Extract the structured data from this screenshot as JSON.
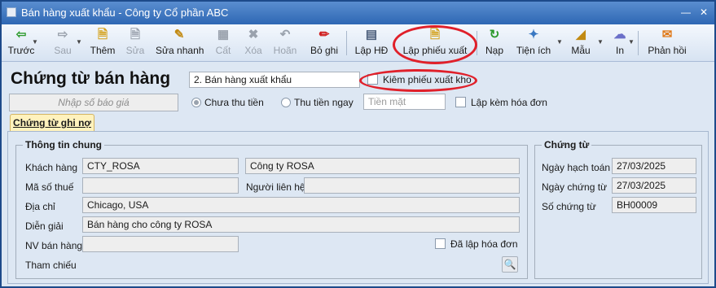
{
  "window": {
    "title": "Bán hàng xuất khẩu - Công ty Cổ phần ABC"
  },
  "toolbar": {
    "items": [
      {
        "label": "Trước",
        "icon": "arrow-left-icon"
      },
      {
        "label": "Sau",
        "icon": "arrow-right-icon"
      },
      {
        "label": "Thêm",
        "icon": "new-document-icon"
      },
      {
        "label": "Sửa",
        "icon": "edit-icon"
      },
      {
        "label": "Sửa nhanh",
        "icon": "quick-edit-icon"
      },
      {
        "label": "Cất",
        "icon": "save-icon"
      },
      {
        "label": "Xóa",
        "icon": "delete-icon"
      },
      {
        "label": "Hoãn",
        "icon": "undo-icon"
      },
      {
        "label": "Bỏ ghi",
        "icon": "unpost-icon"
      },
      {
        "label": "Lập HĐ",
        "icon": "invoice-icon"
      },
      {
        "label": "Lập phiếu xuất",
        "icon": "issue-slip-icon"
      },
      {
        "label": "Nạp",
        "icon": "refresh-icon"
      },
      {
        "label": "Tiện ích",
        "icon": "tools-icon"
      },
      {
        "label": "Mẫu",
        "icon": "template-icon"
      },
      {
        "label": "In",
        "icon": "print-icon"
      },
      {
        "label": "Phản hồi",
        "icon": "feedback-icon"
      }
    ]
  },
  "header": {
    "heading": "Chứng từ bán hàng",
    "voucher_type": "2. Bán hàng xuất khẩu",
    "combined_issue_label": "Kiêm phiếu xuất kho",
    "quote_placeholder": "Nhập số báo giá",
    "payment_options": [
      "Chưa thu tiền",
      "Thu tiền ngay"
    ],
    "payment_method": "Tiền mặt",
    "with_invoice_label": "Lập kèm hóa đơn"
  },
  "tabs": [
    "Chứng từ ghi nợ"
  ],
  "general": {
    "title": "Thông tin chung",
    "customer_label": "Khách hàng",
    "customer_code": "CTY_ROSA",
    "customer_name": "Công ty ROSA",
    "tax_label": "Mã số thuế",
    "tax_code": "",
    "contact_label": "Người liên hệ",
    "contact": "",
    "address_label": "Địa chỉ",
    "address": "Chicago, USA",
    "desc_label": "Diễn giải",
    "description": "Bán hàng cho công ty ROSA",
    "salesperson_label": "NV bán hàng",
    "salesperson": "",
    "invoiced_label": "Đã lập hóa đơn",
    "reference_label": "Tham chiếu"
  },
  "voucher": {
    "title": "Chứng từ",
    "posting_date_label": "Ngày hạch toán",
    "posting_date": "27/03/2025",
    "voucher_date_label": "Ngày chứng từ",
    "voucher_date": "27/03/2025",
    "voucher_no_label": "Số chứng từ",
    "voucher_no": "BH00009"
  },
  "colors": {
    "title_bar": "#2e67b4",
    "annotation": "#e0202a",
    "tab_active": "#fff2bd"
  }
}
